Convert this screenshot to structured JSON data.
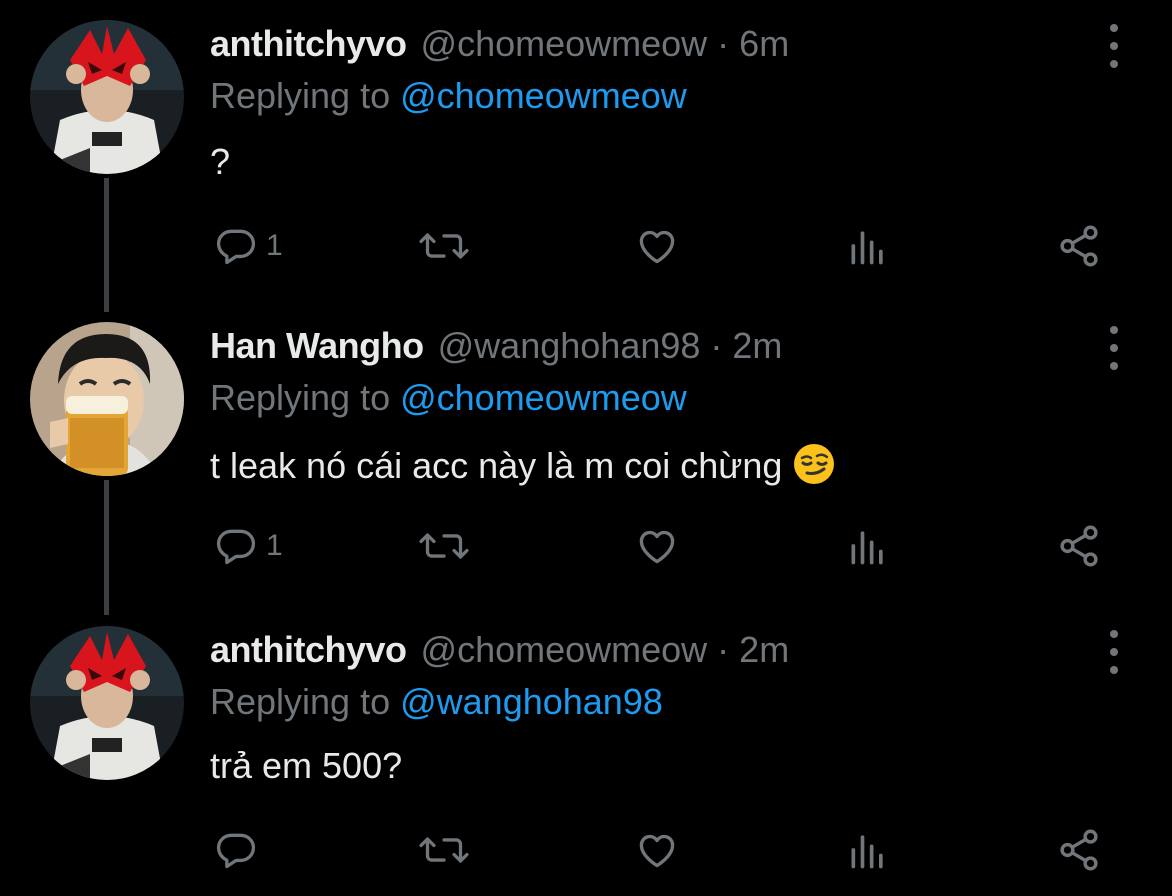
{
  "tweets": [
    {
      "display_name": "anthitchyvo",
      "handle_time": "@chomeowmeow · 6m",
      "replying_prefix": "Replying to ",
      "replying_to": "@chomeowmeow",
      "text": "?",
      "reply_count": "1",
      "avatar": "red-mask-gamer-avatar"
    },
    {
      "display_name": "Han Wangho",
      "handle_time": "@wanghohan98 · 2m",
      "replying_prefix": "Replying to ",
      "replying_to": "@chomeowmeow",
      "text": "t leak nó cái acc này là m coi chừng",
      "emoji": "smirking-face",
      "reply_count": "1",
      "avatar": "person-with-beer-avatar"
    },
    {
      "display_name": "anthitchyvo",
      "handle_time": "@chomeowmeow · 2m",
      "replying_prefix": "Replying to ",
      "replying_to": "@wanghohan98",
      "text": "trả em 500?",
      "reply_count": "",
      "avatar": "red-mask-gamer-avatar"
    }
  ],
  "icons": {
    "reply": "reply-icon",
    "retweet": "retweet-icon",
    "like": "like-icon",
    "views": "views-icon",
    "share": "share-icon",
    "more": "more-options-icon"
  },
  "colors": {
    "background": "#000000",
    "primary_text": "#e7e9ea",
    "secondary_text": "#71767b",
    "link": "#1d9bf0",
    "thread_line": "#3b3f44"
  }
}
